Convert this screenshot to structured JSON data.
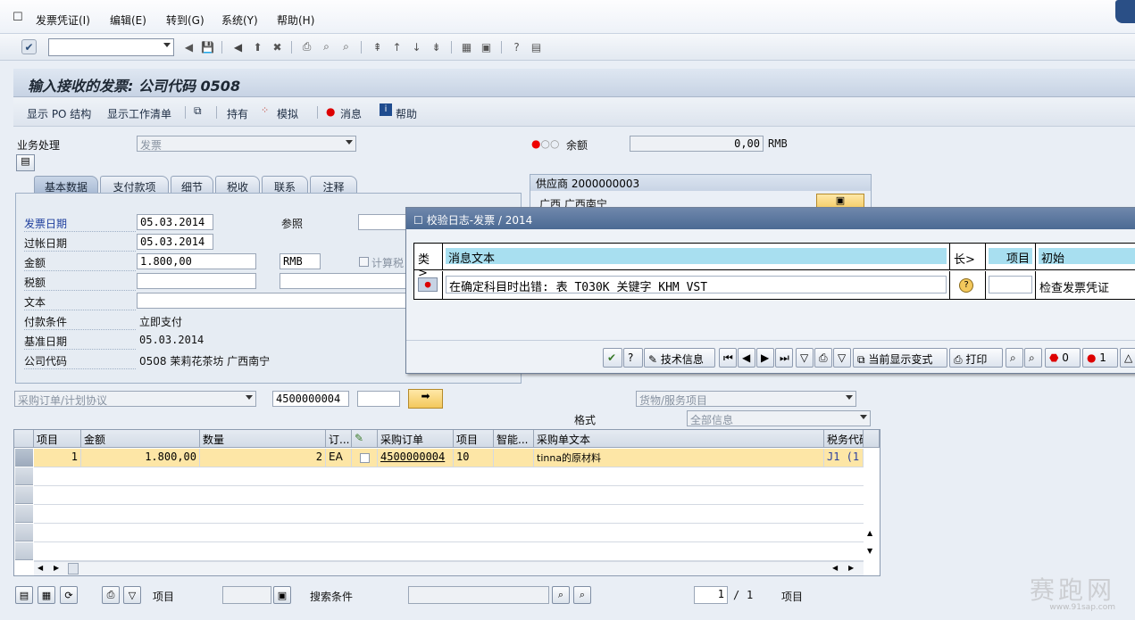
{
  "menu": {
    "items": [
      "发票凭证(I)",
      "编辑(E)",
      "转到(G)",
      "系统(Y)",
      "帮助(H)"
    ]
  },
  "title": "输入接收的发票: 公司代码 0508",
  "app_toolbar": {
    "show_po_structure": "显示 PO 结构",
    "show_worklist": "显示工作清单",
    "hold": "持有",
    "simulate": "模拟",
    "messages": "消息",
    "help": "帮助"
  },
  "header": {
    "transaction_label": "业务处理",
    "transaction_value": "发票",
    "balance_label": "余额",
    "balance_value": "0,00",
    "balance_currency": "RMB"
  },
  "tabs": [
    "基本数据",
    "支付款项",
    "细节",
    "税收",
    "联系",
    "注释"
  ],
  "basic_data": {
    "invoice_date_label": "发票日期",
    "invoice_date": "05.03.2014",
    "reference_label": "参照",
    "posting_date_label": "过帐日期",
    "posting_date": "05.03.2014",
    "amount_label": "金额",
    "amount": "1.800,00",
    "currency": "RMB",
    "calc_tax_label": "计算税",
    "tax_label": "税额",
    "text_label": "文本",
    "payment_terms_label": "付款条件",
    "payment_terms": "立即支付",
    "baseline_date_label": "基准日期",
    "baseline_date": "05.03.2014",
    "company_code_label": "公司代码",
    "company_code": "0508 茉莉花茶坊 广西南宁"
  },
  "vendor": {
    "header": "供应商 2000000003",
    "address": "广西 广西南宁"
  },
  "po_reference": {
    "type": "采购订单/计划协议",
    "number": "4500000004",
    "item_category": "货物/服务项目",
    "layout_label": "格式",
    "layout_value": "全部信息"
  },
  "dialog": {
    "title": "校验日志-发票 / 2014",
    "columns": [
      "类>",
      "消息文本",
      "长>",
      "项目",
      "初始"
    ],
    "row": {
      "message": "在确定科目时出错: 表 T030K 关键字 KHM VST",
      "initial": "检查发票凭证"
    },
    "buttons": {
      "tech_info": "技术信息",
      "current_layout": "当前显示变式",
      "print": "打印",
      "stop_count": "0",
      "error_count": "1"
    }
  },
  "grid": {
    "columns": [
      "项目",
      "金额",
      "数量",
      "订...",
      "",
      "采购订单",
      "项目",
      "智能...",
      "采购单文本",
      "税务代码"
    ],
    "rows": [
      {
        "item": "1",
        "amount": "1.800,00",
        "qty": "2",
        "unit": "EA",
        "po": "4500000004",
        "po_item": "10",
        "text": "tinna的原材料",
        "tax": "J1 (1"
      }
    ]
  },
  "footer": {
    "item_label": "项目",
    "search_label": "搜索条件",
    "page_current": "1",
    "page_sep": "/",
    "page_total": "1",
    "page_suffix": "项目"
  },
  "watermark": {
    "text": "赛跑网",
    "url": "www.91sap.com"
  }
}
